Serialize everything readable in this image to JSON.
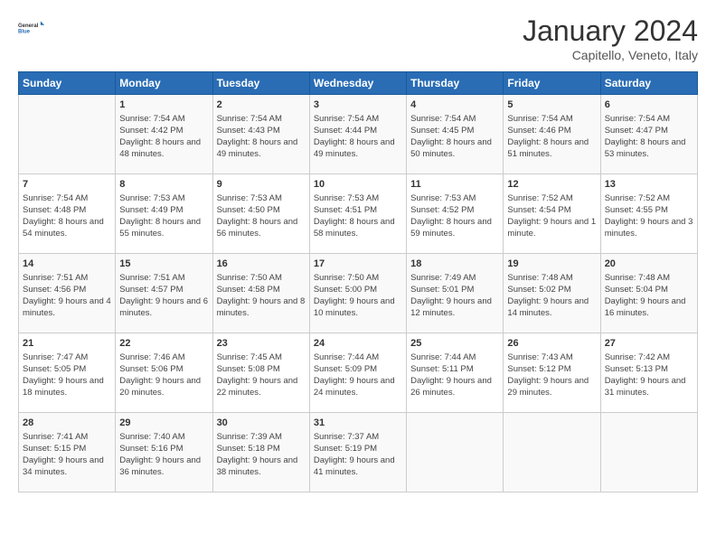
{
  "header": {
    "logo_line1": "General",
    "logo_line2": "Blue",
    "month": "January 2024",
    "location": "Capitello, Veneto, Italy"
  },
  "weekdays": [
    "Sunday",
    "Monday",
    "Tuesday",
    "Wednesday",
    "Thursday",
    "Friday",
    "Saturday"
  ],
  "weeks": [
    [
      {
        "day": "",
        "content": ""
      },
      {
        "day": "1",
        "content": "Sunrise: 7:54 AM\nSunset: 4:42 PM\nDaylight: 8 hours\nand 48 minutes."
      },
      {
        "day": "2",
        "content": "Sunrise: 7:54 AM\nSunset: 4:43 PM\nDaylight: 8 hours\nand 49 minutes."
      },
      {
        "day": "3",
        "content": "Sunrise: 7:54 AM\nSunset: 4:44 PM\nDaylight: 8 hours\nand 49 minutes."
      },
      {
        "day": "4",
        "content": "Sunrise: 7:54 AM\nSunset: 4:45 PM\nDaylight: 8 hours\nand 50 minutes."
      },
      {
        "day": "5",
        "content": "Sunrise: 7:54 AM\nSunset: 4:46 PM\nDaylight: 8 hours\nand 51 minutes."
      },
      {
        "day": "6",
        "content": "Sunrise: 7:54 AM\nSunset: 4:47 PM\nDaylight: 8 hours\nand 53 minutes."
      }
    ],
    [
      {
        "day": "7",
        "content": "Sunrise: 7:54 AM\nSunset: 4:48 PM\nDaylight: 8 hours\nand 54 minutes."
      },
      {
        "day": "8",
        "content": "Sunrise: 7:53 AM\nSunset: 4:49 PM\nDaylight: 8 hours\nand 55 minutes."
      },
      {
        "day": "9",
        "content": "Sunrise: 7:53 AM\nSunset: 4:50 PM\nDaylight: 8 hours\nand 56 minutes."
      },
      {
        "day": "10",
        "content": "Sunrise: 7:53 AM\nSunset: 4:51 PM\nDaylight: 8 hours\nand 58 minutes."
      },
      {
        "day": "11",
        "content": "Sunrise: 7:53 AM\nSunset: 4:52 PM\nDaylight: 8 hours\nand 59 minutes."
      },
      {
        "day": "12",
        "content": "Sunrise: 7:52 AM\nSunset: 4:54 PM\nDaylight: 9 hours\nand 1 minute."
      },
      {
        "day": "13",
        "content": "Sunrise: 7:52 AM\nSunset: 4:55 PM\nDaylight: 9 hours\nand 3 minutes."
      }
    ],
    [
      {
        "day": "14",
        "content": "Sunrise: 7:51 AM\nSunset: 4:56 PM\nDaylight: 9 hours\nand 4 minutes."
      },
      {
        "day": "15",
        "content": "Sunrise: 7:51 AM\nSunset: 4:57 PM\nDaylight: 9 hours\nand 6 minutes."
      },
      {
        "day": "16",
        "content": "Sunrise: 7:50 AM\nSunset: 4:58 PM\nDaylight: 9 hours\nand 8 minutes."
      },
      {
        "day": "17",
        "content": "Sunrise: 7:50 AM\nSunset: 5:00 PM\nDaylight: 9 hours\nand 10 minutes."
      },
      {
        "day": "18",
        "content": "Sunrise: 7:49 AM\nSunset: 5:01 PM\nDaylight: 9 hours\nand 12 minutes."
      },
      {
        "day": "19",
        "content": "Sunrise: 7:48 AM\nSunset: 5:02 PM\nDaylight: 9 hours\nand 14 minutes."
      },
      {
        "day": "20",
        "content": "Sunrise: 7:48 AM\nSunset: 5:04 PM\nDaylight: 9 hours\nand 16 minutes."
      }
    ],
    [
      {
        "day": "21",
        "content": "Sunrise: 7:47 AM\nSunset: 5:05 PM\nDaylight: 9 hours\nand 18 minutes."
      },
      {
        "day": "22",
        "content": "Sunrise: 7:46 AM\nSunset: 5:06 PM\nDaylight: 9 hours\nand 20 minutes."
      },
      {
        "day": "23",
        "content": "Sunrise: 7:45 AM\nSunset: 5:08 PM\nDaylight: 9 hours\nand 22 minutes."
      },
      {
        "day": "24",
        "content": "Sunrise: 7:44 AM\nSunset: 5:09 PM\nDaylight: 9 hours\nand 24 minutes."
      },
      {
        "day": "25",
        "content": "Sunrise: 7:44 AM\nSunset: 5:11 PM\nDaylight: 9 hours\nand 26 minutes."
      },
      {
        "day": "26",
        "content": "Sunrise: 7:43 AM\nSunset: 5:12 PM\nDaylight: 9 hours\nand 29 minutes."
      },
      {
        "day": "27",
        "content": "Sunrise: 7:42 AM\nSunset: 5:13 PM\nDaylight: 9 hours\nand 31 minutes."
      }
    ],
    [
      {
        "day": "28",
        "content": "Sunrise: 7:41 AM\nSunset: 5:15 PM\nDaylight: 9 hours\nand 34 minutes."
      },
      {
        "day": "29",
        "content": "Sunrise: 7:40 AM\nSunset: 5:16 PM\nDaylight: 9 hours\nand 36 minutes."
      },
      {
        "day": "30",
        "content": "Sunrise: 7:39 AM\nSunset: 5:18 PM\nDaylight: 9 hours\nand 38 minutes."
      },
      {
        "day": "31",
        "content": "Sunrise: 7:37 AM\nSunset: 5:19 PM\nDaylight: 9 hours\nand 41 minutes."
      },
      {
        "day": "",
        "content": ""
      },
      {
        "day": "",
        "content": ""
      },
      {
        "day": "",
        "content": ""
      }
    ]
  ]
}
